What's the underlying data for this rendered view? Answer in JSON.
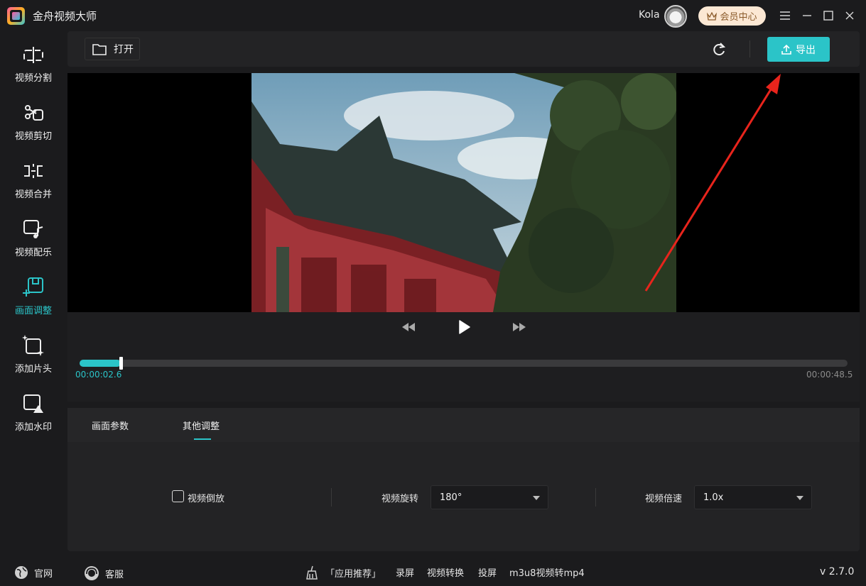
{
  "app": {
    "title": "金舟视频大师",
    "user": "Kola",
    "vip_label": "会员中心",
    "version": "v 2.7.0"
  },
  "sidebar": {
    "items": [
      {
        "label": "视频分割",
        "icon": "split-icon"
      },
      {
        "label": "视频剪切",
        "icon": "scissors-icon"
      },
      {
        "label": "视频合并",
        "icon": "merge-icon"
      },
      {
        "label": "视频配乐",
        "icon": "music-icon"
      },
      {
        "label": "画面调整",
        "icon": "adjust-icon",
        "active": true
      },
      {
        "label": "添加片头",
        "icon": "intro-icon"
      },
      {
        "label": "添加水印",
        "icon": "watermark-icon"
      }
    ]
  },
  "toolbar": {
    "open_label": "打开",
    "export_label": "导出"
  },
  "player": {
    "current_time": "00:00:02.6",
    "total_time": "00:00:48.5",
    "progress": 0.054
  },
  "panel": {
    "tabs": [
      {
        "label": "画面参数"
      },
      {
        "label": "其他调整",
        "active": true
      }
    ],
    "reverse_label": "视频倒放",
    "reverse_checked": false,
    "rotate_label": "视频旋转",
    "rotate_value": "180°",
    "speed_label": "视频倍速",
    "speed_value": "1.0x"
  },
  "footer": {
    "website": "官网",
    "service": "客服",
    "recommend": "「应用推荐」",
    "links": [
      "录屏",
      "视频转换",
      "投屏",
      "m3u8视频转mp4"
    ]
  },
  "colors": {
    "accent": "#2bc4c8",
    "background": "#1b1b1d",
    "vip": "#fce8d4",
    "annotation_arrow": "#e8241c"
  }
}
